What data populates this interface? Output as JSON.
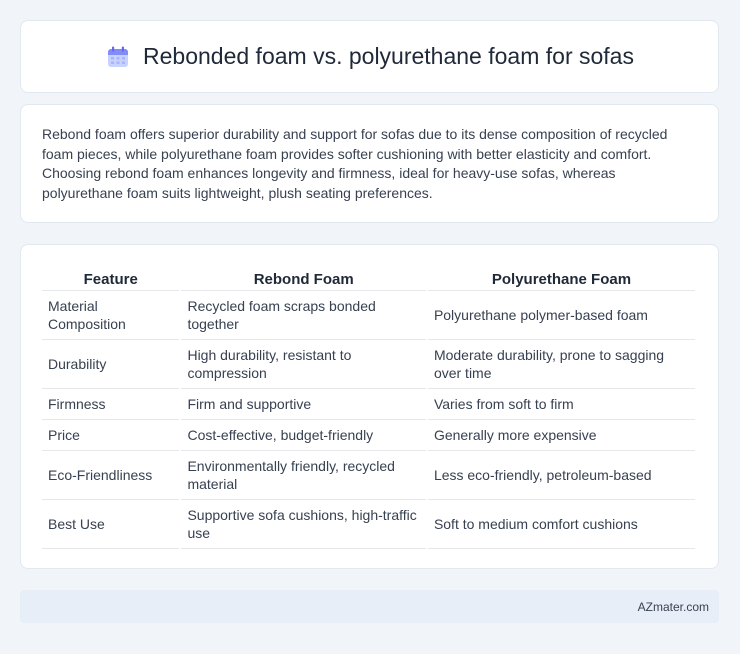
{
  "header": {
    "title": "Rebonded foam vs. polyurethane foam for sofas",
    "icon": "calendar-icon"
  },
  "summary": {
    "text": "Rebond foam offers superior durability and support for sofas due to its dense composition of recycled foam pieces, while polyurethane foam provides softer cushioning with better elasticity and comfort. Choosing rebond foam enhances longevity and firmness, ideal for heavy-use sofas, whereas polyurethane foam suits lightweight, plush seating preferences."
  },
  "table": {
    "headers": [
      "Feature",
      "Rebond Foam",
      "Polyurethane Foam"
    ],
    "rows": [
      [
        "Material Composition",
        "Recycled foam scraps bonded together",
        "Polyurethane polymer-based foam"
      ],
      [
        "Durability",
        "High durability, resistant to compression",
        "Moderate durability, prone to sagging over time"
      ],
      [
        "Firmness",
        "Firm and supportive",
        "Varies from soft to firm"
      ],
      [
        "Price",
        "Cost-effective, budget-friendly",
        "Generally more expensive"
      ],
      [
        "Eco-Friendliness",
        "Environmentally friendly, recycled material",
        "Less eco-friendly, petroleum-based"
      ],
      [
        "Best Use",
        "Supportive sofa cushions, high-traffic use",
        "Soft to medium comfort cushions"
      ]
    ]
  },
  "footer": {
    "source": "AZmater.com"
  }
}
